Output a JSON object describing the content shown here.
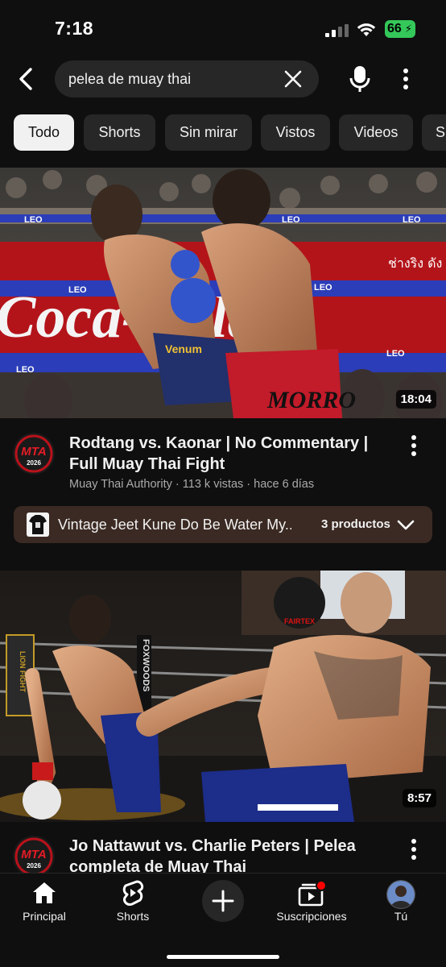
{
  "status_bar": {
    "time": "7:18",
    "battery": "66"
  },
  "search": {
    "query": "pelea de muay thai"
  },
  "chips": [
    {
      "label": "Todo",
      "active": true
    },
    {
      "label": "Shorts"
    },
    {
      "label": "Sin mirar"
    },
    {
      "label": "Vistos"
    },
    {
      "label": "Videos"
    },
    {
      "label": "Su"
    }
  ],
  "videos": [
    {
      "duration": "18:04",
      "channel_avatar_text": "MTA",
      "channel_avatar_sub": "2026",
      "title": "Rodtang vs. Kaonar | No Commentary | Full Muay Thai Fight",
      "meta": "Muay Thai Authority · 113 k vistas · hace 6 días"
    },
    {
      "duration": "8:57",
      "channel_avatar_text": "MTA",
      "channel_avatar_sub": "2026",
      "title": "Jo Nattawut vs. Charlie Peters | Pelea completa de Muay Thai"
    }
  ],
  "thumb_text": {
    "leo": "LEO",
    "coca": "Coca-Cola",
    "thai": "ช่างริง ดัง",
    "pants_left": "Venum",
    "pants_right": "MORRO",
    "foxwoods": "FOXWOODS",
    "lion_fight": "LION FIGHT",
    "glove": "FAIRTEX"
  },
  "shopping": {
    "label": "Vintage Jeet Kune Do Be Water My...",
    "count": "3 productos"
  },
  "nav": [
    {
      "label": "Principal",
      "icon": "home-icon",
      "active": true
    },
    {
      "label": "Shorts",
      "icon": "shorts-icon"
    },
    {
      "label": "",
      "icon": "add-icon"
    },
    {
      "label": "Suscripciones",
      "icon": "subscriptions-icon"
    },
    {
      "label": "Tú",
      "icon": "avatar"
    }
  ],
  "colors": {
    "background": "#0f0f0f",
    "chip": "#272727",
    "chip_active": "#f1f1f1",
    "battery": "#34c759",
    "shopping_bar": "#3b2a23"
  }
}
